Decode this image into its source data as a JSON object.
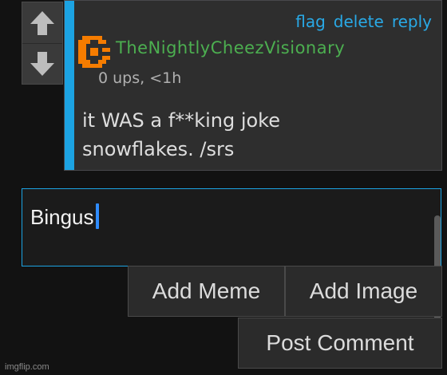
{
  "vote": {
    "up_icon": "arrow-up-icon",
    "down_icon": "arrow-down-icon"
  },
  "comment": {
    "actions": {
      "flag": "flag",
      "delete": "delete",
      "reply": "reply"
    },
    "avatar_icon": "orange-pixel-avatar",
    "username": "TheNightlyCheezVisionary",
    "meta": "0 ups, <1h",
    "text_line1": "it WAS a f**king joke",
    "text_line2": "snowflakes. /srs",
    "accent_color": "#1ca3e3",
    "username_color": "#4caf50"
  },
  "composer": {
    "value": "Bingus"
  },
  "buttons": {
    "add_meme": "Add Meme",
    "add_image": "Add Image",
    "post_comment": "Post Comment"
  },
  "watermark": "imgflip.com"
}
